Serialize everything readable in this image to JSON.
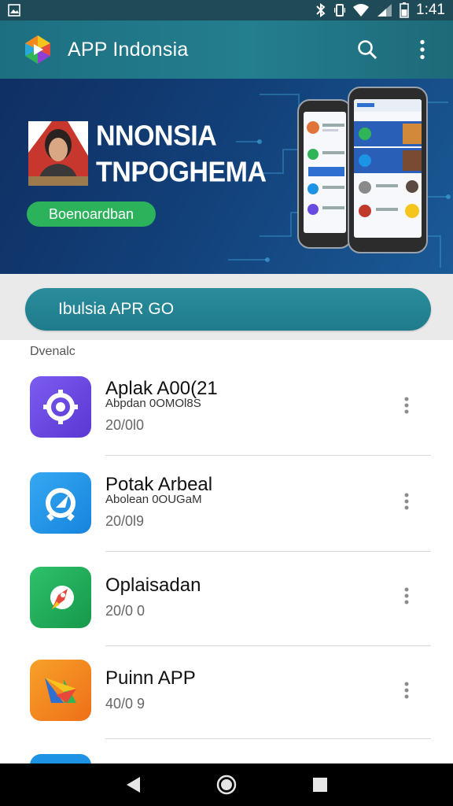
{
  "status_bar": {
    "time": "1:41"
  },
  "app_bar": {
    "title": "APP Indonsia"
  },
  "banner": {
    "title_line1": "NNONSIA",
    "title_line2": "TNPOGHEMA",
    "cta_label": "Boenoardban"
  },
  "search": {
    "placeholder": "Ibulsia APR GO"
  },
  "list": {
    "section_label": "Dvenalc",
    "items": [
      {
        "name": "Aplak A00(21",
        "subtitle": "Abpdan 0OMOl8S",
        "date": "20/0l0",
        "icon": "purple-gear-icon",
        "color": "#6a4be0"
      },
      {
        "name": "Potak Arbeal",
        "subtitle": "Abolean 0OUGaM",
        "date": "20/0l9",
        "icon": "blue-compass-icon",
        "color": "#1e93e6"
      },
      {
        "name": "Oplaisadan",
        "subtitle": "",
        "date": "20/0 0",
        "icon": "green-rocket-icon",
        "color": "#1fa85a"
      },
      {
        "name": "Puinn APP",
        "subtitle": "",
        "date": "40/0 9",
        "icon": "orange-arrow-icon",
        "color": "#f38a1d"
      }
    ]
  },
  "colors": {
    "status_bar": "#1f4a57",
    "app_bar": "#1d6f80",
    "banner": "#123f78",
    "cta": "#2bb25b",
    "search_bar": "#2a8d9c"
  }
}
